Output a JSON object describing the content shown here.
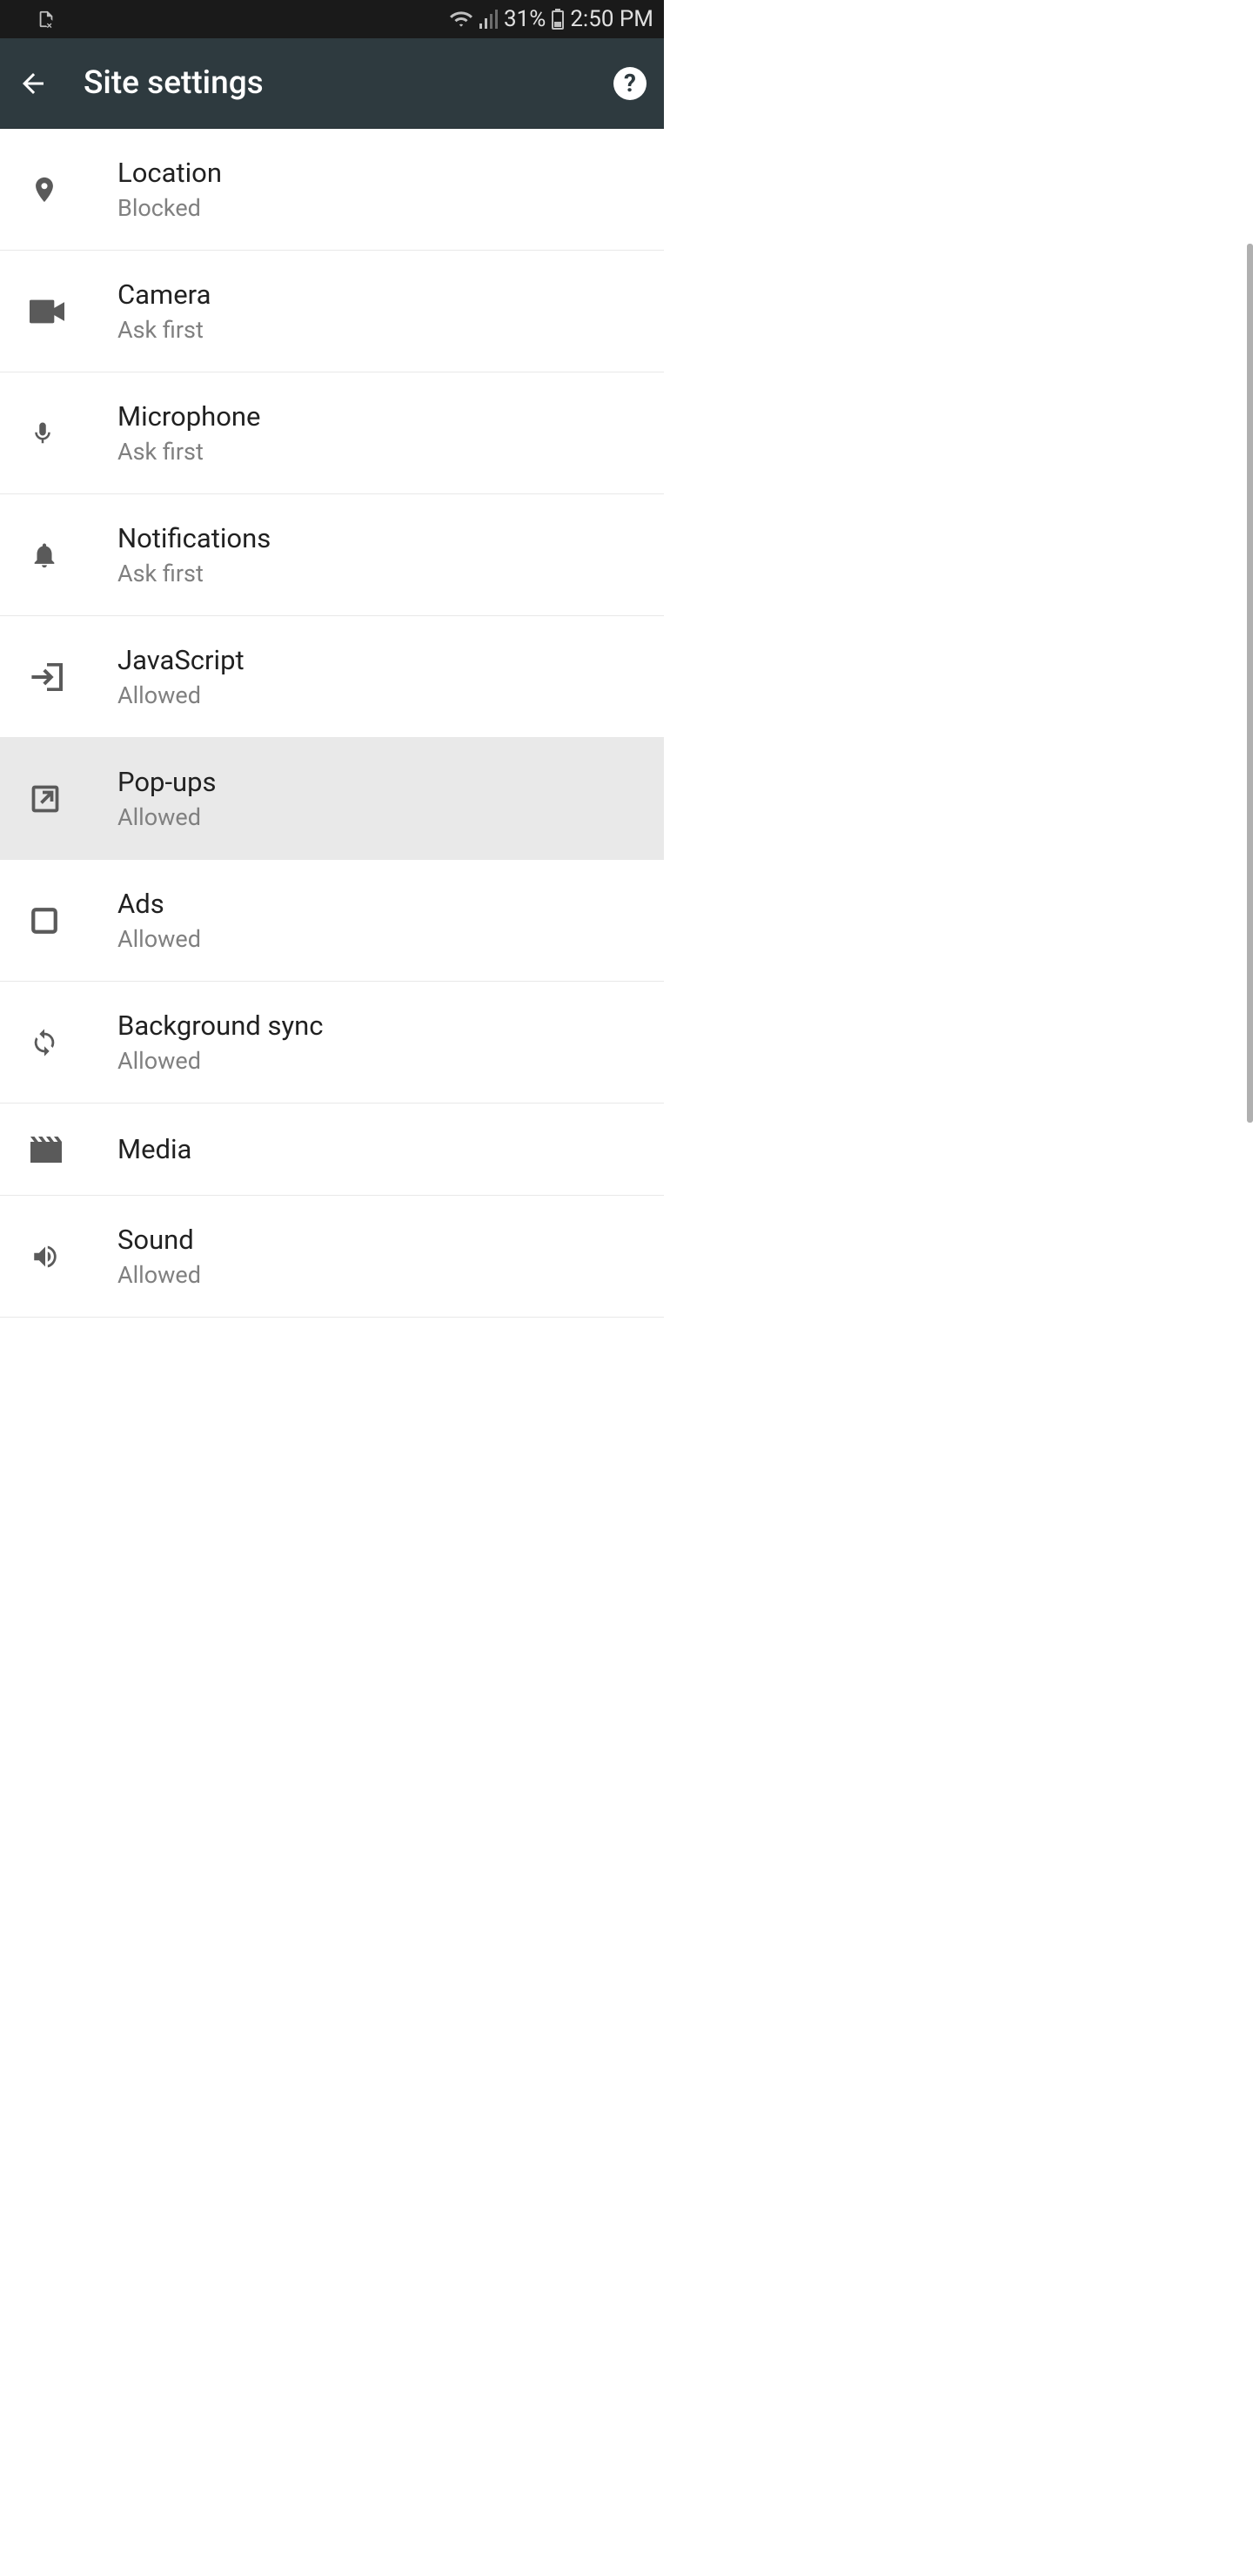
{
  "status": {
    "battery_pct": "31%",
    "time": "2:50 PM"
  },
  "header": {
    "title": "Site settings"
  },
  "settings": [
    {
      "id": "location",
      "icon": "location-pin-icon",
      "title": "Location",
      "sub": "Blocked",
      "selected": false
    },
    {
      "id": "camera",
      "icon": "camera-icon",
      "title": "Camera",
      "sub": "Ask first",
      "selected": false
    },
    {
      "id": "microphone",
      "icon": "microphone-icon",
      "title": "Microphone",
      "sub": "Ask first",
      "selected": false
    },
    {
      "id": "notifications",
      "icon": "bell-icon",
      "title": "Notifications",
      "sub": "Ask first",
      "selected": false
    },
    {
      "id": "javascript",
      "icon": "arrow-in-box-icon",
      "title": "JavaScript",
      "sub": "Allowed",
      "selected": false
    },
    {
      "id": "popups",
      "icon": "open-external-icon",
      "title": "Pop-ups",
      "sub": "Allowed",
      "selected": true
    },
    {
      "id": "ads",
      "icon": "square-icon",
      "title": "Ads",
      "sub": "Allowed",
      "selected": false
    },
    {
      "id": "background-sync",
      "icon": "sync-icon",
      "title": "Background sync",
      "sub": "Allowed",
      "selected": false
    },
    {
      "id": "media",
      "icon": "clapperboard-icon",
      "title": "Media",
      "sub": null,
      "selected": false
    },
    {
      "id": "sound",
      "icon": "speaker-icon",
      "title": "Sound",
      "sub": "Allowed",
      "selected": false
    }
  ]
}
